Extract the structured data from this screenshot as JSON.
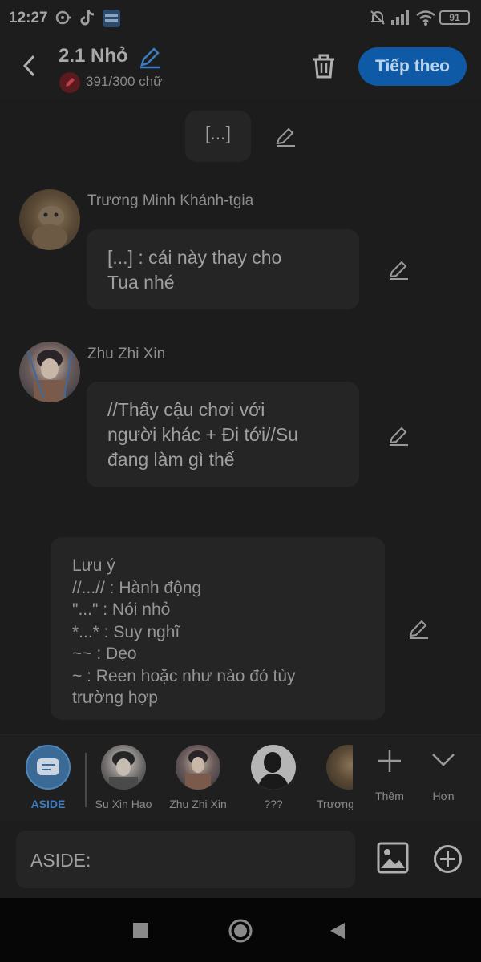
{
  "status": {
    "time": "12:27",
    "battery": "91"
  },
  "header": {
    "title": "2.1 Nhỏ",
    "word_count": "391/300 chữ",
    "next_label": "Tiếp theo"
  },
  "messages": [
    {
      "type": "system",
      "text": "[...]"
    },
    {
      "type": "char",
      "sender": "Trương Minh Khánh-tgia",
      "text": "[...] : cái này thay cho\nTua nhé"
    },
    {
      "type": "char",
      "sender": "Zhu Zhi Xin",
      "text": "//Thấy cậu chơi với\nngười khác + Đi tới//Su\nđang làm gì thế"
    },
    {
      "type": "note",
      "text": "Lưu ý\n//...// : Hành động\n\"...\" : Nói nhỏ\n*...* : Suy nghĩ\n~~ : Dẹo\n~ : Reen hoặc như nào đó tùy\ntrường hợp"
    }
  ],
  "characters": [
    {
      "name": "ASIDE",
      "selected": true
    },
    {
      "name": "Su Xin Hao"
    },
    {
      "name": "Zhu Zhi Xin"
    },
    {
      "name": "???"
    },
    {
      "name": "Trương"
    }
  ],
  "tools": {
    "add_label": "Thêm",
    "more_label": "Hơn"
  },
  "input": {
    "value": "ASIDE:"
  },
  "colors": {
    "accent": "#0f5aa6",
    "selected_char": "#3a6a95",
    "background": "#1c1c1c",
    "bubble": "#252525"
  }
}
